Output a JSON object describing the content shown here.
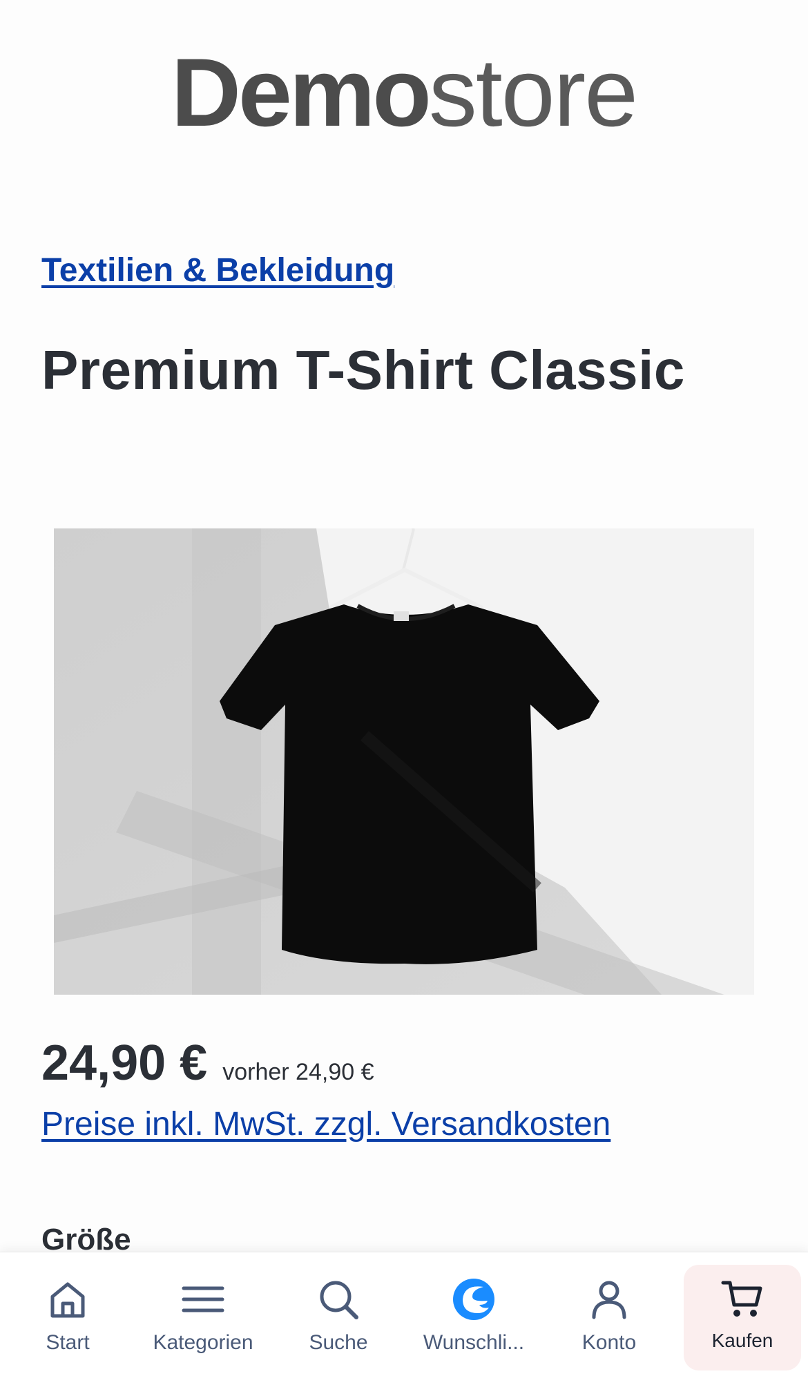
{
  "logo": {
    "bold": "Demo",
    "light": "store"
  },
  "breadcrumb": {
    "category": "Textilien & Bekleidung"
  },
  "product": {
    "title": "Premium T-Shirt Classic",
    "price": "24,90 €",
    "old_price": "vorher 24,90 €",
    "tax_note": "Preise inkl. MwSt. zzgl. Versandkosten",
    "size_label": "Größe"
  },
  "nav": {
    "items": [
      {
        "label": "Start",
        "icon": "home-icon"
      },
      {
        "label": "Kategorien",
        "icon": "menu-icon"
      },
      {
        "label": "Suche",
        "icon": "search-icon"
      },
      {
        "label": "Wunschli...",
        "icon": "wishlist-logo-icon"
      },
      {
        "label": "Konto",
        "icon": "account-icon"
      },
      {
        "label": "Kaufen",
        "icon": "cart-icon"
      }
    ],
    "active_index": 5
  },
  "colors": {
    "link": "#0b3fa8",
    "icon": "#4a5a78",
    "wishlist_accent": "#1a8cff",
    "active_bg": "#fbeeee"
  }
}
